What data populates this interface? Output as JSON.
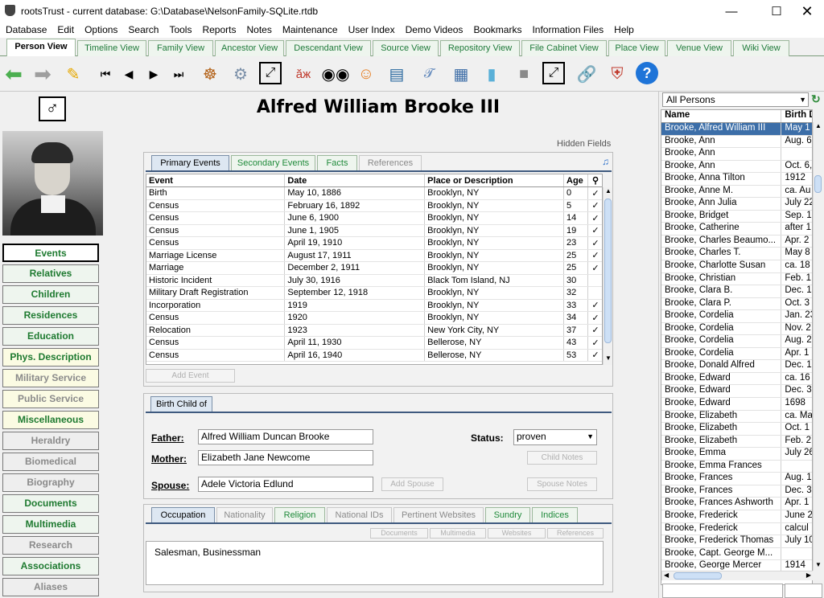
{
  "window": {
    "title": "rootsTrust - current database: G:\\Database\\NelsonFamily-SQLite.rtdb"
  },
  "menu": [
    "Database",
    "Edit",
    "Options",
    "Search",
    "Tools",
    "Reports",
    "Notes",
    "Maintenance",
    "User Index",
    "Demo Videos",
    "Bookmarks",
    "Information Files",
    "Help"
  ],
  "view_tabs": [
    "Person View",
    "Timeline View",
    "Family View",
    "Ancestor View",
    "Descendant View",
    "Source View",
    "Repository View",
    "File Cabinet View",
    "Place View",
    "Venue View",
    "Wiki View"
  ],
  "person": {
    "name": "Alfred William Brooke III",
    "gender_symbol": "♂"
  },
  "sidebar": [
    {
      "label": "Events",
      "style": "sel"
    },
    {
      "label": "Relatives",
      "style": "green"
    },
    {
      "label": "Children",
      "style": "green"
    },
    {
      "label": "Residences",
      "style": "green"
    },
    {
      "label": "Education",
      "style": "green"
    },
    {
      "label": "Phys. Description",
      "style": "yellow"
    },
    {
      "label": "Military Service",
      "style": "yellowgray"
    },
    {
      "label": "Public Service",
      "style": "yellowgray"
    },
    {
      "label": "Miscellaneous",
      "style": "yellow"
    },
    {
      "label": "Heraldry",
      "style": "gray"
    },
    {
      "label": "Biomedical",
      "style": "gray"
    },
    {
      "label": "Biography",
      "style": "gray"
    },
    {
      "label": "Documents",
      "style": "green"
    },
    {
      "label": "Multimedia",
      "style": "green"
    },
    {
      "label": "Research",
      "style": "gray"
    },
    {
      "label": "Associations",
      "style": "green"
    },
    {
      "label": "Aliases",
      "style": "gray"
    }
  ],
  "hidden_fields": "Hidden Fields",
  "events_panel": {
    "tabs": [
      "Primary Events",
      "Secondary Events",
      "Facts",
      "References"
    ],
    "columns": [
      "Event",
      "Date",
      "Place or Description",
      "Age"
    ],
    "rows": [
      [
        "Birth",
        "May 10, 1886",
        "Brooklyn, NY",
        "0",
        "✓"
      ],
      [
        "Census",
        "February 16, 1892",
        "Brooklyn, NY",
        "5",
        "✓"
      ],
      [
        "Census",
        "June 6, 1900",
        "Brooklyn, NY",
        "14",
        "✓"
      ],
      [
        "Census",
        "June 1, 1905",
        "Brooklyn, NY",
        "19",
        "✓"
      ],
      [
        "Census",
        "April 19, 1910",
        "Brooklyn, NY",
        "23",
        "✓"
      ],
      [
        "Marriage License",
        "August 17, 1911",
        "Brooklyn, NY",
        "25",
        "✓"
      ],
      [
        "Marriage",
        "December 2, 1911",
        "Brooklyn, NY",
        "25",
        "✓"
      ],
      [
        "Historic Incident",
        "July 30, 1916",
        "Black Tom Island, NJ",
        "30",
        ""
      ],
      [
        "Military Draft Registration",
        "September 12, 1918",
        "Brooklyn, NY",
        "32",
        ""
      ],
      [
        "Incorporation",
        "1919",
        "Brooklyn, NY",
        "33",
        "✓"
      ],
      [
        "Census",
        "1920",
        "Brooklyn, NY",
        "34",
        "✓"
      ],
      [
        "Relocation",
        "1923",
        "New York City, NY",
        "37",
        "✓"
      ],
      [
        "Census",
        "April 11, 1930",
        "Bellerose, NY",
        "43",
        "✓"
      ],
      [
        "Census",
        "April 16, 1940",
        "Bellerose, NY",
        "53",
        "✓"
      ]
    ],
    "add_button": "Add Event"
  },
  "birth_child": {
    "tab": "Birth Child of",
    "father_label": "Father:",
    "father": "Alfred William Duncan Brooke",
    "mother_label": "Mother:",
    "mother": "Elizabeth Jane Newcome",
    "status_label": "Status:",
    "status": "proven",
    "child_notes": "Child Notes",
    "spouse_label": "Spouse:",
    "spouse": "Adele Victoria Edlund",
    "add_spouse": "Add Spouse",
    "spouse_notes": "Spouse Notes"
  },
  "occupation_panel": {
    "tabs": [
      "Occupation",
      "Nationality",
      "Religion",
      "National IDs",
      "Pertinent Websites",
      "Sundry",
      "Indices"
    ],
    "sub_buttons": [
      "Documents",
      "Multimedia",
      "Websites",
      "References"
    ],
    "text": "Salesman, Businessman"
  },
  "person_list": {
    "filter": "All Persons",
    "columns": [
      "Name",
      "Birth D"
    ],
    "rows": [
      [
        "Brooke, Alfred William III",
        "May 1"
      ],
      [
        "Brooke, Ann",
        "Aug. 6"
      ],
      [
        "Brooke, Ann",
        ""
      ],
      [
        "Brooke, Ann",
        "Oct. 6,"
      ],
      [
        "Brooke, Anna Tilton",
        "1912"
      ],
      [
        "Brooke, Anne M.",
        "ca. Au"
      ],
      [
        "Brooke, Ann Julia",
        "July 22"
      ],
      [
        "Brooke, Bridget",
        "Sep. 1"
      ],
      [
        "Brooke, Catherine",
        "after 1"
      ],
      [
        "Brooke, Charles Beaumo...",
        "Apr. 2"
      ],
      [
        "Brooke, Charles T.",
        "May 8"
      ],
      [
        "Brooke, Charlotte Susan",
        "ca. 18"
      ],
      [
        "Brooke, Christian",
        "Feb. 1"
      ],
      [
        "Brooke, Clara B.",
        "Dec. 1"
      ],
      [
        "Brooke, Clara P.",
        "Oct. 3"
      ],
      [
        "Brooke, Cordelia",
        "Jan. 23"
      ],
      [
        "Brooke, Cordelia",
        "Nov. 2"
      ],
      [
        "Brooke, Cordelia",
        "Aug. 2"
      ],
      [
        "Brooke, Cordelia",
        "Apr. 1"
      ],
      [
        "Brooke, Donald Alfred",
        "Dec. 1"
      ],
      [
        "Brooke, Edward",
        "ca. 16"
      ],
      [
        "Brooke, Edward",
        "Dec. 3"
      ],
      [
        "Brooke, Edward",
        "1698"
      ],
      [
        "Brooke, Elizabeth",
        "ca. Ma"
      ],
      [
        "Brooke, Elizabeth",
        "Oct. 1"
      ],
      [
        "Brooke, Elizabeth",
        "Feb. 2"
      ],
      [
        "Brooke, Emma",
        "July 26"
      ],
      [
        "Brooke, Emma Frances",
        ""
      ],
      [
        "Brooke, Frances",
        "Aug. 1"
      ],
      [
        "Brooke, Frances",
        "Dec. 3"
      ],
      [
        "Brooke, Frances Ashworth",
        "Apr. 1"
      ],
      [
        "Brooke, Frederick",
        "June 2"
      ],
      [
        "Brooke, Frederick",
        "calcul"
      ],
      [
        "Brooke, Frederick Thomas",
        "July 10"
      ],
      [
        "Brooke, Capt. George M...",
        ""
      ],
      [
        "Brooke, George Mercer",
        "1914"
      ]
    ]
  }
}
